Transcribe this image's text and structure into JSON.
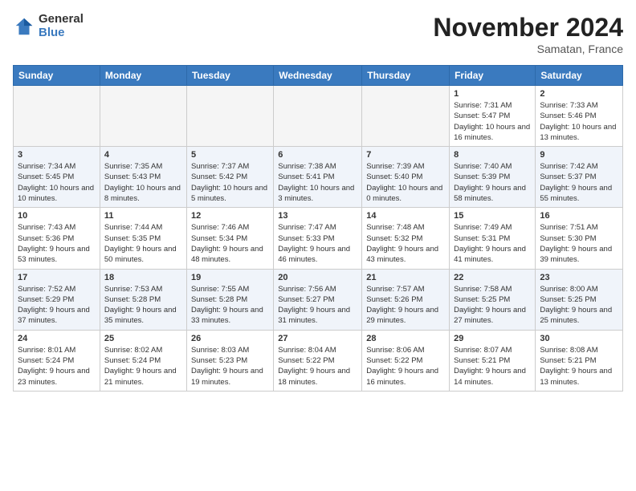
{
  "logo": {
    "general": "General",
    "blue": "Blue"
  },
  "title": "November 2024",
  "location": "Samatan, France",
  "days_header": [
    "Sunday",
    "Monday",
    "Tuesday",
    "Wednesday",
    "Thursday",
    "Friday",
    "Saturday"
  ],
  "weeks": [
    [
      {
        "day": "",
        "empty": true
      },
      {
        "day": "",
        "empty": true
      },
      {
        "day": "",
        "empty": true
      },
      {
        "day": "",
        "empty": true
      },
      {
        "day": "",
        "empty": true
      },
      {
        "day": "1",
        "sunrise": "7:31 AM",
        "sunset": "5:47 PM",
        "daylight": "10 hours and 16 minutes."
      },
      {
        "day": "2",
        "sunrise": "7:33 AM",
        "sunset": "5:46 PM",
        "daylight": "10 hours and 13 minutes."
      }
    ],
    [
      {
        "day": "3",
        "sunrise": "7:34 AM",
        "sunset": "5:45 PM",
        "daylight": "10 hours and 10 minutes."
      },
      {
        "day": "4",
        "sunrise": "7:35 AM",
        "sunset": "5:43 PM",
        "daylight": "10 hours and 8 minutes."
      },
      {
        "day": "5",
        "sunrise": "7:37 AM",
        "sunset": "5:42 PM",
        "daylight": "10 hours and 5 minutes."
      },
      {
        "day": "6",
        "sunrise": "7:38 AM",
        "sunset": "5:41 PM",
        "daylight": "10 hours and 3 minutes."
      },
      {
        "day": "7",
        "sunrise": "7:39 AM",
        "sunset": "5:40 PM",
        "daylight": "10 hours and 0 minutes."
      },
      {
        "day": "8",
        "sunrise": "7:40 AM",
        "sunset": "5:39 PM",
        "daylight": "9 hours and 58 minutes."
      },
      {
        "day": "9",
        "sunrise": "7:42 AM",
        "sunset": "5:37 PM",
        "daylight": "9 hours and 55 minutes."
      }
    ],
    [
      {
        "day": "10",
        "sunrise": "7:43 AM",
        "sunset": "5:36 PM",
        "daylight": "9 hours and 53 minutes."
      },
      {
        "day": "11",
        "sunrise": "7:44 AM",
        "sunset": "5:35 PM",
        "daylight": "9 hours and 50 minutes."
      },
      {
        "day": "12",
        "sunrise": "7:46 AM",
        "sunset": "5:34 PM",
        "daylight": "9 hours and 48 minutes."
      },
      {
        "day": "13",
        "sunrise": "7:47 AM",
        "sunset": "5:33 PM",
        "daylight": "9 hours and 46 minutes."
      },
      {
        "day": "14",
        "sunrise": "7:48 AM",
        "sunset": "5:32 PM",
        "daylight": "9 hours and 43 minutes."
      },
      {
        "day": "15",
        "sunrise": "7:49 AM",
        "sunset": "5:31 PM",
        "daylight": "9 hours and 41 minutes."
      },
      {
        "day": "16",
        "sunrise": "7:51 AM",
        "sunset": "5:30 PM",
        "daylight": "9 hours and 39 minutes."
      }
    ],
    [
      {
        "day": "17",
        "sunrise": "7:52 AM",
        "sunset": "5:29 PM",
        "daylight": "9 hours and 37 minutes."
      },
      {
        "day": "18",
        "sunrise": "7:53 AM",
        "sunset": "5:28 PM",
        "daylight": "9 hours and 35 minutes."
      },
      {
        "day": "19",
        "sunrise": "7:55 AM",
        "sunset": "5:28 PM",
        "daylight": "9 hours and 33 minutes."
      },
      {
        "day": "20",
        "sunrise": "7:56 AM",
        "sunset": "5:27 PM",
        "daylight": "9 hours and 31 minutes."
      },
      {
        "day": "21",
        "sunrise": "7:57 AM",
        "sunset": "5:26 PM",
        "daylight": "9 hours and 29 minutes."
      },
      {
        "day": "22",
        "sunrise": "7:58 AM",
        "sunset": "5:25 PM",
        "daylight": "9 hours and 27 minutes."
      },
      {
        "day": "23",
        "sunrise": "8:00 AM",
        "sunset": "5:25 PM",
        "daylight": "9 hours and 25 minutes."
      }
    ],
    [
      {
        "day": "24",
        "sunrise": "8:01 AM",
        "sunset": "5:24 PM",
        "daylight": "9 hours and 23 minutes."
      },
      {
        "day": "25",
        "sunrise": "8:02 AM",
        "sunset": "5:24 PM",
        "daylight": "9 hours and 21 minutes."
      },
      {
        "day": "26",
        "sunrise": "8:03 AM",
        "sunset": "5:23 PM",
        "daylight": "9 hours and 19 minutes."
      },
      {
        "day": "27",
        "sunrise": "8:04 AM",
        "sunset": "5:22 PM",
        "daylight": "9 hours and 18 minutes."
      },
      {
        "day": "28",
        "sunrise": "8:06 AM",
        "sunset": "5:22 PM",
        "daylight": "9 hours and 16 minutes."
      },
      {
        "day": "29",
        "sunrise": "8:07 AM",
        "sunset": "5:21 PM",
        "daylight": "9 hours and 14 minutes."
      },
      {
        "day": "30",
        "sunrise": "8:08 AM",
        "sunset": "5:21 PM",
        "daylight": "9 hours and 13 minutes."
      }
    ]
  ],
  "labels": {
    "sunrise": "Sunrise:",
    "sunset": "Sunset:",
    "daylight": "Daylight:"
  }
}
